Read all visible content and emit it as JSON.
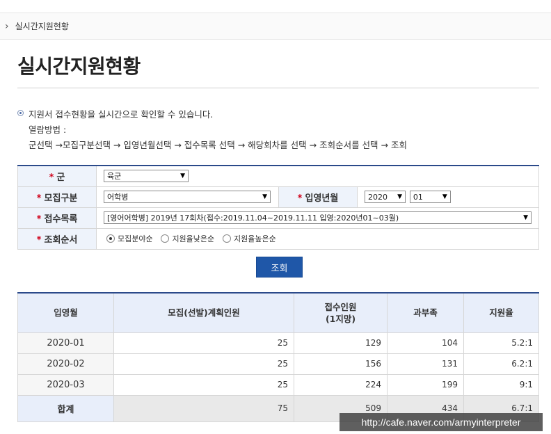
{
  "breadcrumb": {
    "current": "실시간지원현황"
  },
  "page": {
    "title": "실시간지원현황"
  },
  "info": {
    "line1": "지원서 접수현황을 실시간으로 확인할 수 있습니다.",
    "line2": "열람방법 :",
    "line3": "군선택 →모집구분선택 → 입영년월선택 → 접수목록 선택 → 해당회차를 선택 → 조회순서를 선택 → 조회"
  },
  "form": {
    "required_mark": "*",
    "army": {
      "label": "군",
      "value": "육군"
    },
    "category": {
      "label": "모집구분",
      "value": "어학병"
    },
    "enlist": {
      "label": "입영년월",
      "year": "2020",
      "month": "01"
    },
    "receipt": {
      "label": "접수목록",
      "value": "[영어어학병] 2019년 17회차(접수:2019.11.04~2019.11.11 입영:2020년01~03월)"
    },
    "order": {
      "label": "조회순서",
      "options": [
        "모집분야순",
        "지원율낮은순",
        "지원율높은순"
      ],
      "selected": 0
    }
  },
  "search_button": "조회",
  "table": {
    "headers": [
      "입영월",
      "모집(선발)계획인원",
      "접수인원\n(1지망)",
      "과부족",
      "지원율"
    ],
    "header_line_a": "접수인원",
    "header_line_b": "(1지망)",
    "rows": [
      {
        "month": "2020-01",
        "plan": "25",
        "applied": "129",
        "diff": "104",
        "rate": "5.2:1"
      },
      {
        "month": "2020-02",
        "plan": "25",
        "applied": "156",
        "diff": "131",
        "rate": "6.2:1"
      },
      {
        "month": "2020-03",
        "plan": "25",
        "applied": "224",
        "diff": "199",
        "rate": "9:1"
      }
    ],
    "total": {
      "label": "합계",
      "plan": "75",
      "applied": "509",
      "diff": "434",
      "rate": "6.7:1"
    }
  },
  "watermark": "http://cafe.naver.com/armyinterpreter"
}
